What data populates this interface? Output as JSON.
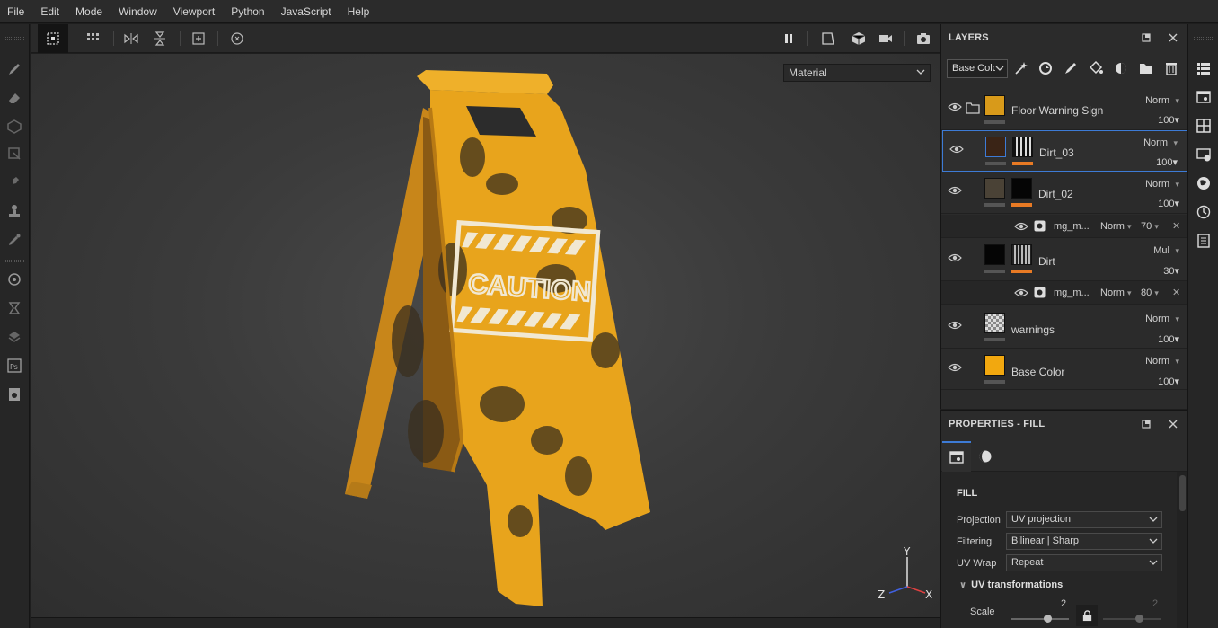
{
  "menu": [
    "File",
    "Edit",
    "Mode",
    "Window",
    "Viewport",
    "Python",
    "JavaScript",
    "Help"
  ],
  "viewport": {
    "material_mode": "Material",
    "sign_text": "CAUTION",
    "axis": {
      "x": "X",
      "y": "Y",
      "z": "Z"
    }
  },
  "layers_panel": {
    "title": "LAYERS",
    "channel": "Base Colo",
    "layers": [
      {
        "name": "Floor Warning Sign",
        "blend": "Norm",
        "opacity": "100",
        "type": "folder"
      },
      {
        "name": "Dirt_03",
        "blend": "Norm",
        "opacity": "100",
        "type": "fill",
        "selected": true
      },
      {
        "name": "Dirt_02",
        "blend": "Norm",
        "opacity": "100",
        "type": "fill"
      },
      {
        "name": "Dirt",
        "blend": "Mul",
        "opacity": "30",
        "type": "fill"
      },
      {
        "name": "warnings",
        "blend": "Norm",
        "opacity": "100",
        "type": "paint"
      },
      {
        "name": "Base Color",
        "blend": "Norm",
        "opacity": "100",
        "type": "fill"
      }
    ],
    "masks": [
      {
        "name": "mg_m...",
        "blend": "Norm",
        "opacity": "70"
      },
      {
        "name": "mg_m...",
        "blend": "Norm",
        "opacity": "80"
      }
    ]
  },
  "properties_panel": {
    "title": "PROPERTIES - FILL",
    "section": "FILL",
    "fields": [
      {
        "label": "Projection",
        "value": "UV projection"
      },
      {
        "label": "Filtering",
        "value": "Bilinear | Sharp"
      },
      {
        "label": "UV Wrap",
        "value": "Repeat"
      }
    ],
    "uv_transformations": "UV transformations",
    "scale_label": "Scale",
    "scale_u": "2",
    "scale_v": "2"
  },
  "colors": {
    "accent": "#3d7bd6",
    "sign": "#e8a41c",
    "orange_bar": "#e87a24"
  }
}
